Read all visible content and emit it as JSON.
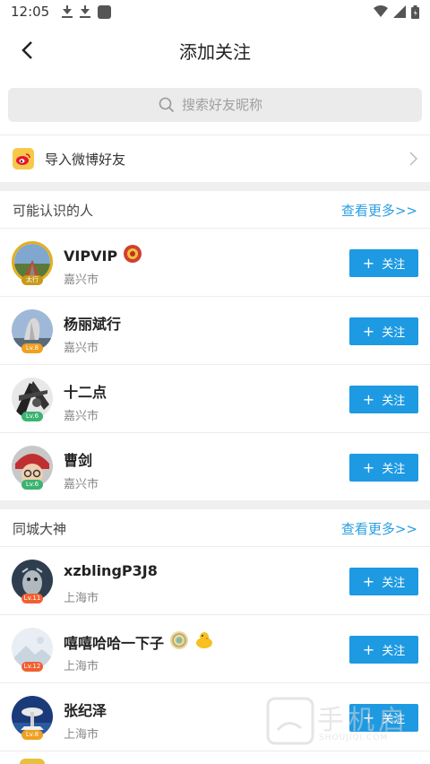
{
  "status_bar": {
    "time": "12:05",
    "icons": [
      "download-icon",
      "download-icon",
      "notification-square-icon",
      "wifi-icon",
      "signal-icon",
      "battery-icon"
    ]
  },
  "header": {
    "title": "添加关注",
    "back_icon": "chevron-left-icon"
  },
  "search": {
    "placeholder": "搜索好友昵称",
    "icon": "search-icon"
  },
  "import_row": {
    "label": "导入微博好友",
    "icon": "weibo-icon"
  },
  "sections": [
    {
      "title": "可能认识的人",
      "see_more": "查看更多>>",
      "users": [
        {
          "name": "VIPVIP",
          "city": "嘉兴市",
          "badge": "太行",
          "badge_color": "#c99a1a",
          "follow": "关注",
          "medals": [
            "red-medal-icon"
          ]
        },
        {
          "name": "杨丽斌行",
          "city": "嘉兴市",
          "badge": "Lv.8",
          "badge_color": "#f0a020",
          "follow": "关注",
          "medals": []
        },
        {
          "name": "十二点",
          "city": "嘉兴市",
          "badge": "Lv.6",
          "badge_color": "#3cb371",
          "follow": "关注",
          "medals": []
        },
        {
          "name": "曹剑",
          "city": "嘉兴市",
          "badge": "Lv.6",
          "badge_color": "#3cb371",
          "follow": "关注",
          "medals": []
        }
      ]
    },
    {
      "title": "同城大神",
      "see_more": "查看更多>>",
      "users": [
        {
          "name": "xzblingP3J8",
          "city": "上海市",
          "badge": "Lv.11",
          "badge_color": "#f06030",
          "follow": "关注",
          "medals": []
        },
        {
          "name": "嘻嘻哈哈一下子",
          "city": "上海市",
          "badge": "Lv.12",
          "badge_color": "#f06030",
          "follow": "关注",
          "medals": [
            "gold-medal-icon",
            "duck-medal-icon"
          ]
        },
        {
          "name": "张纪泽",
          "city": "上海市",
          "badge": "Lv.8",
          "badge_color": "#f0a020",
          "follow": "关注",
          "medals": []
        }
      ]
    }
  ],
  "watermark": {
    "text": "手机启",
    "sub": "SHOUJIQI.COM"
  },
  "colors": {
    "accent": "#1e9ae2",
    "link": "#2a9ee0",
    "divider": "#ececec"
  }
}
